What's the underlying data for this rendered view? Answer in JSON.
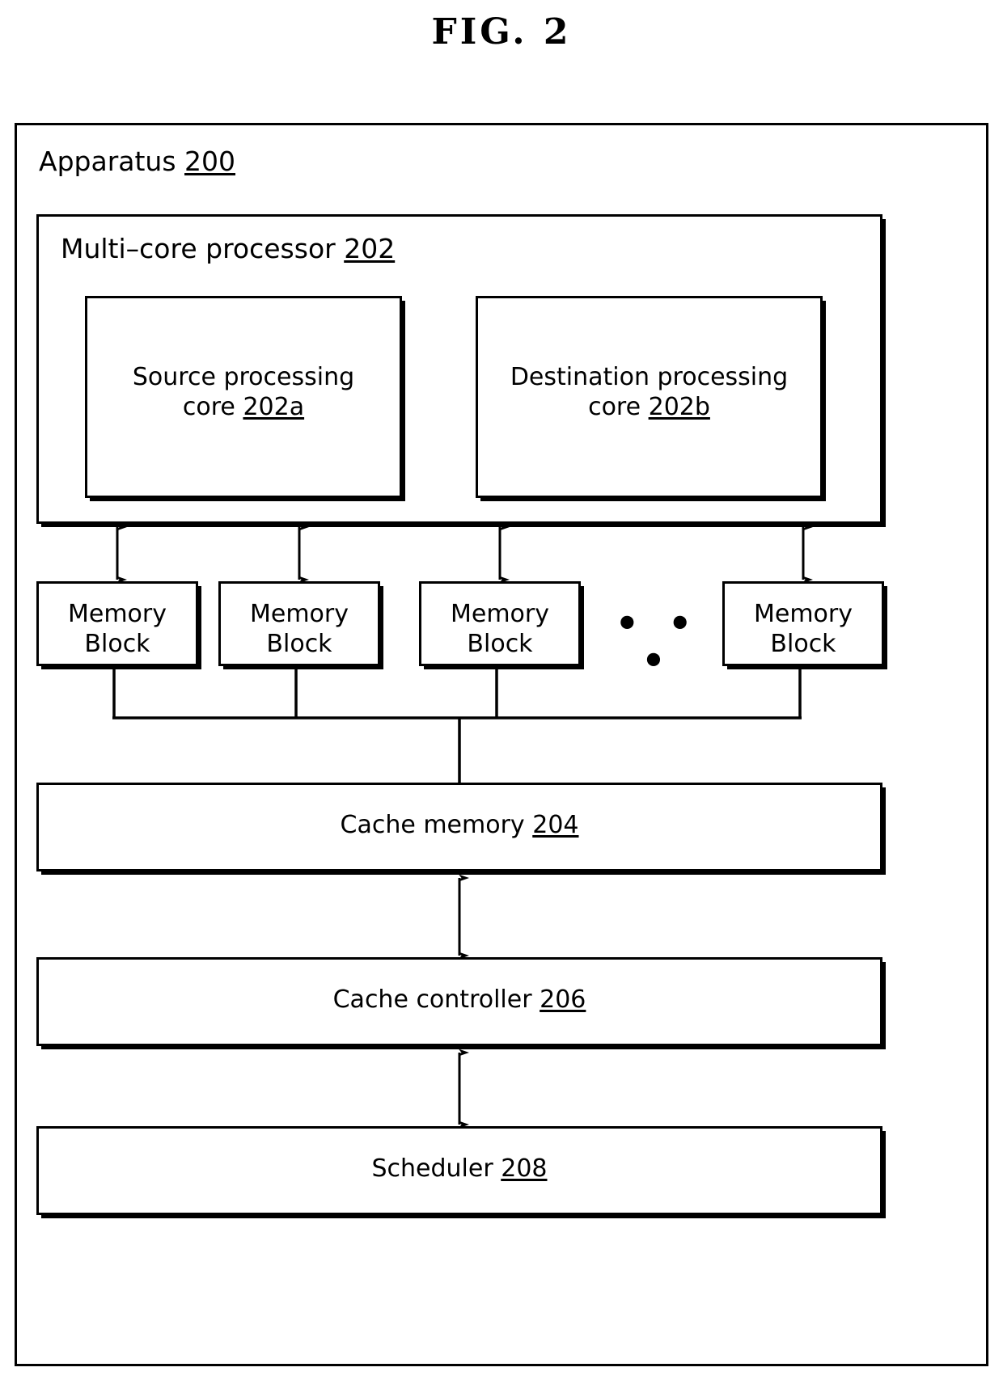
{
  "figure": {
    "title": "FIG.  2"
  },
  "apparatus": {
    "label": "Apparatus",
    "ref": "200"
  },
  "processor": {
    "label": "Multi–core processor",
    "ref": "202"
  },
  "cores": [
    {
      "name": "source-core",
      "line1": "Source processing",
      "line2": "core",
      "ref": "202a"
    },
    {
      "name": "destination-core",
      "line1": "Destination processing",
      "line2": "core",
      "ref": "202b"
    }
  ],
  "memory_blocks": [
    {
      "line1": "Memory",
      "line2": "Block"
    },
    {
      "line1": "Memory",
      "line2": "Block"
    },
    {
      "line1": "Memory",
      "line2": "Block"
    },
    {
      "line1": "Memory",
      "line2": "Block"
    }
  ],
  "memory_ellipsis": "• • •",
  "cache_memory": {
    "label": "Cache memory",
    "ref": "204"
  },
  "cache_controller": {
    "label": "Cache controller",
    "ref": "206"
  },
  "scheduler": {
    "label": "Scheduler",
    "ref": "208"
  },
  "colors": {
    "ink": "#000000",
    "paper": "#ffffff"
  }
}
